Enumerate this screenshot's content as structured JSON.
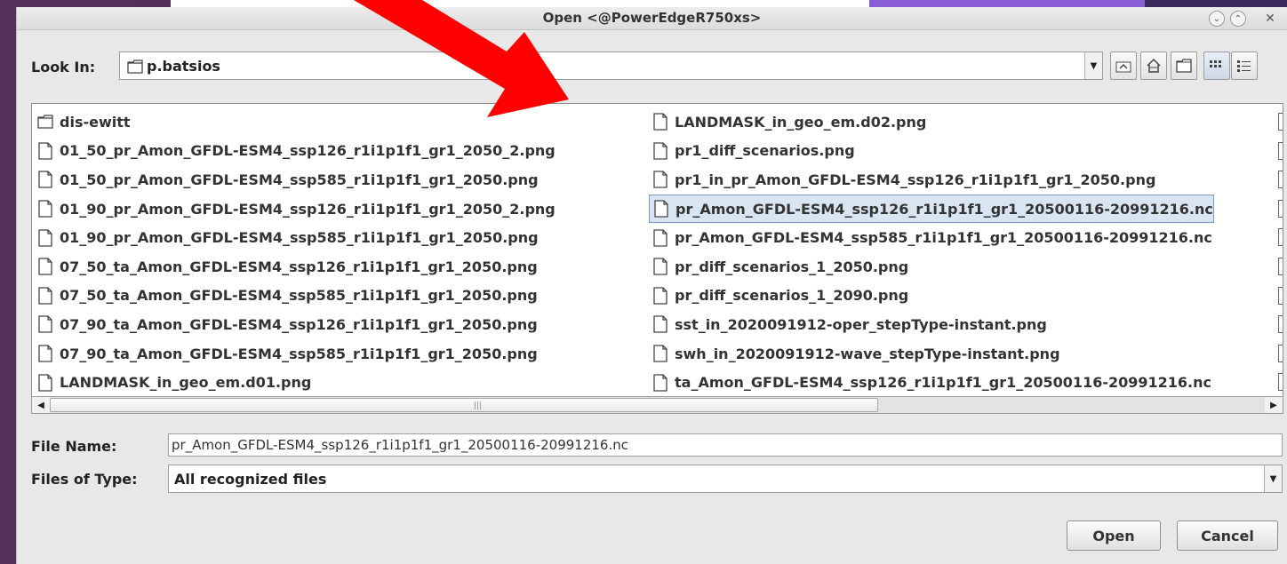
{
  "window": {
    "title": "Open <@PowerEdgeR750xs>"
  },
  "look_in": {
    "label": "Look In:",
    "value": "p.batsios"
  },
  "toolbar_icons": [
    "up-one-level-icon",
    "home-icon",
    "new-folder-icon",
    "list-view-icon",
    "details-view-icon"
  ],
  "files": {
    "column1": [
      {
        "name": "dis-ewitt",
        "type": "folder"
      },
      {
        "name": "01_50_pr_Amon_GFDL-ESM4_ssp126_r1i1p1f1_gr1_2050_2.png",
        "type": "file"
      },
      {
        "name": "01_50_pr_Amon_GFDL-ESM4_ssp585_r1i1p1f1_gr1_2050.png",
        "type": "file"
      },
      {
        "name": "01_90_pr_Amon_GFDL-ESM4_ssp126_r1i1p1f1_gr1_2050_2.png",
        "type": "file"
      },
      {
        "name": "01_90_pr_Amon_GFDL-ESM4_ssp585_r1i1p1f1_gr1_2050.png",
        "type": "file"
      },
      {
        "name": "07_50_ta_Amon_GFDL-ESM4_ssp126_r1i1p1f1_gr1_2050.png",
        "type": "file"
      },
      {
        "name": "07_50_ta_Amon_GFDL-ESM4_ssp585_r1i1p1f1_gr1_2050.png",
        "type": "file"
      },
      {
        "name": "07_90_ta_Amon_GFDL-ESM4_ssp126_r1i1p1f1_gr1_2050.png",
        "type": "file"
      },
      {
        "name": "07_90_ta_Amon_GFDL-ESM4_ssp585_r1i1p1f1_gr1_2050.png",
        "type": "file"
      },
      {
        "name": "LANDMASK_in_geo_em.d01.png",
        "type": "file"
      }
    ],
    "column2": [
      {
        "name": "LANDMASK_in_geo_em.d02.png",
        "type": "file"
      },
      {
        "name": "pr1_diff_scenarios.png",
        "type": "file"
      },
      {
        "name": "pr1_in_pr_Amon_GFDL-ESM4_ssp126_r1i1p1f1_gr1_2050.png",
        "type": "file"
      },
      {
        "name": "pr_Amon_GFDL-ESM4_ssp126_r1i1p1f1_gr1_20500116-20991216.nc",
        "type": "file",
        "selected": true
      },
      {
        "name": "pr_Amon_GFDL-ESM4_ssp585_r1i1p1f1_gr1_20500116-20991216.nc",
        "type": "file"
      },
      {
        "name": "pr_diff_scenarios_1_2050.png",
        "type": "file"
      },
      {
        "name": "pr_diff_scenarios_1_2090.png",
        "type": "file"
      },
      {
        "name": "sst_in_2020091912-oper_stepType-instant.png",
        "type": "file"
      },
      {
        "name": "swh_in_2020091912-wave_stepType-instant.png",
        "type": "file"
      },
      {
        "name": "ta_Amon_GFDL-ESM4_ssp126_r1i1p1f1_gr1_20500116-20991216.nc",
        "type": "file"
      }
    ]
  },
  "file_name": {
    "label": "File Name:",
    "value": "pr_Amon_GFDL-ESM4_ssp126_r1i1p1f1_gr1_20500116-20991216.nc"
  },
  "files_of_type": {
    "label": "Files of Type:",
    "value": "All recognized files"
  },
  "buttons": {
    "open": "Open",
    "cancel": "Cancel"
  },
  "colors": {
    "selection_bg": "#dae5f2",
    "annotation_arrow": "#ff0000"
  }
}
